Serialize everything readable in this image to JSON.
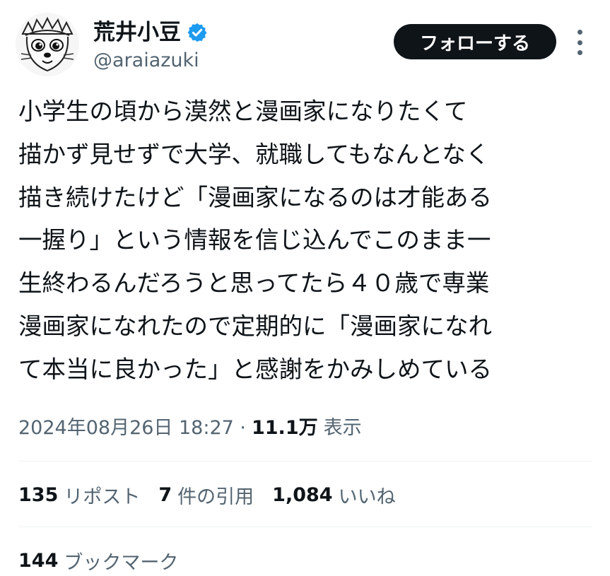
{
  "user": {
    "display_name": "荒井小豆",
    "handle": "@araiazuki",
    "verified_badge_icon": "verified-badge-icon",
    "badge_color": "#1d9bf0"
  },
  "actions": {
    "follow_label": "フォローする",
    "more_icon": "more-vertical-icon"
  },
  "tweet": {
    "lines": [
      "小学生の頃から漠然と漫画家になりたくて",
      "描かず見せずで大学、就職してもなんとなく",
      "描き続けたけど「漫画家になるのは才能ある",
      "一握り」という情報を信じ込んでこのまま一",
      "生終わるんだろうと思ってたら４０歳で専業",
      "漫画家になれたので定期的に「漫画家になれ",
      "て本当に良かった」と感謝をかみしめている"
    ],
    "timestamp": "2024年08月26日 18:27 ·",
    "views_count": "11.1万",
    "views_label": "表示"
  },
  "stats": {
    "reposts": {
      "count": "135",
      "label": "リポスト"
    },
    "quotes": {
      "count": "7",
      "label": "件の引用"
    },
    "likes": {
      "count": "1,084",
      "label": "いいね"
    },
    "bookmarks": {
      "count": "144",
      "label": "ブックマーク"
    }
  },
  "colors": {
    "text_primary": "#0f1419",
    "text_secondary": "#536471",
    "follow_bg": "#0f1419",
    "divider": "#eff3f4"
  }
}
